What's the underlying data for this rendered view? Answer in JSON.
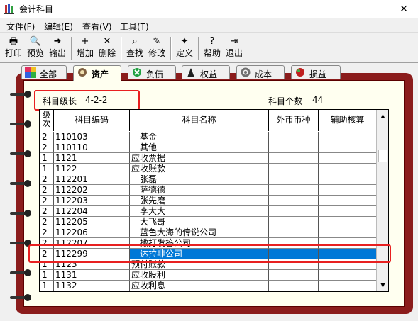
{
  "window": {
    "title": "会计科目",
    "close_glyph": "✕"
  },
  "menu": [
    "文件(F)",
    "编辑(E)",
    "查看(V)",
    "工具(T)"
  ],
  "toolbar": [
    {
      "label": "打印",
      "icon": "printer-icon",
      "glyph": "🖶"
    },
    {
      "label": "预览",
      "icon": "preview-icon",
      "glyph": "🔍"
    },
    {
      "label": "输出",
      "icon": "export-icon",
      "glyph": "➜"
    },
    {
      "label": "增加",
      "icon": "add-icon",
      "glyph": "+"
    },
    {
      "label": "删除",
      "icon": "delete-icon",
      "glyph": "✕"
    },
    {
      "label": "查找",
      "icon": "find-icon",
      "glyph": "⌕"
    },
    {
      "label": "修改",
      "icon": "edit-icon",
      "glyph": "✎"
    },
    {
      "label": "定义",
      "icon": "define-icon",
      "glyph": "✦"
    },
    {
      "label": "帮助",
      "icon": "help-icon",
      "glyph": "?"
    },
    {
      "label": "退出",
      "icon": "exit-icon",
      "glyph": "⇥"
    }
  ],
  "tabs": [
    {
      "label": "全部",
      "icon": "all-icon",
      "color": "#d04060"
    },
    {
      "label": "资产",
      "icon": "asset-icon",
      "color": "#806040"
    },
    {
      "label": "负债",
      "icon": "liability-icon",
      "color": "#20a040"
    },
    {
      "label": "权益",
      "icon": "equity-icon",
      "color": "#202020"
    },
    {
      "label": "成本",
      "icon": "cost-icon",
      "color": "#808080"
    },
    {
      "label": "损益",
      "icon": "pnl-icon",
      "color": "#c02020"
    }
  ],
  "info": {
    "level_label": "科目级长",
    "level_value": "4-2-2",
    "count_label": "科目个数",
    "count_value": "44"
  },
  "grid": {
    "headers": {
      "level": "级次",
      "code": "科目编码",
      "name": "科目名称",
      "currency": "外币币种",
      "aux": "辅助核算"
    },
    "rows": [
      {
        "level": "2",
        "code": "110103",
        "name": "基金",
        "indent": 2
      },
      {
        "level": "2",
        "code": "110110",
        "name": "其他",
        "indent": 2
      },
      {
        "level": "1",
        "code": "1121",
        "name": "应收票据",
        "indent": 0
      },
      {
        "level": "1",
        "code": "1122",
        "name": "应收账款",
        "indent": 0
      },
      {
        "level": "2",
        "code": "112201",
        "name": "张磊",
        "indent": 2
      },
      {
        "level": "2",
        "code": "112202",
        "name": "萨德德",
        "indent": 2
      },
      {
        "level": "2",
        "code": "112203",
        "name": "张先磨",
        "indent": 2
      },
      {
        "level": "2",
        "code": "112204",
        "name": "李大大",
        "indent": 2
      },
      {
        "level": "2",
        "code": "112205",
        "name": "大飞哥",
        "indent": 2
      },
      {
        "level": "2",
        "code": "112206",
        "name": "蓝色大海的传说公司",
        "indent": 2
      },
      {
        "level": "2",
        "code": "112207",
        "name": "撒打发答公司",
        "indent": 2
      },
      {
        "level": "2",
        "code": "112299",
        "name": "达拉非公司",
        "indent": 2,
        "selected": true
      },
      {
        "level": "1",
        "code": "1123",
        "name": "预付账款",
        "indent": 0
      },
      {
        "level": "1",
        "code": "1131",
        "name": "应收股利",
        "indent": 0
      },
      {
        "level": "1",
        "code": "1132",
        "name": "应收利息",
        "indent": 0
      }
    ]
  },
  "colors": {
    "selection": "#0078d7",
    "highlight_box": "#e82020",
    "binder": "#8b1c1c"
  }
}
